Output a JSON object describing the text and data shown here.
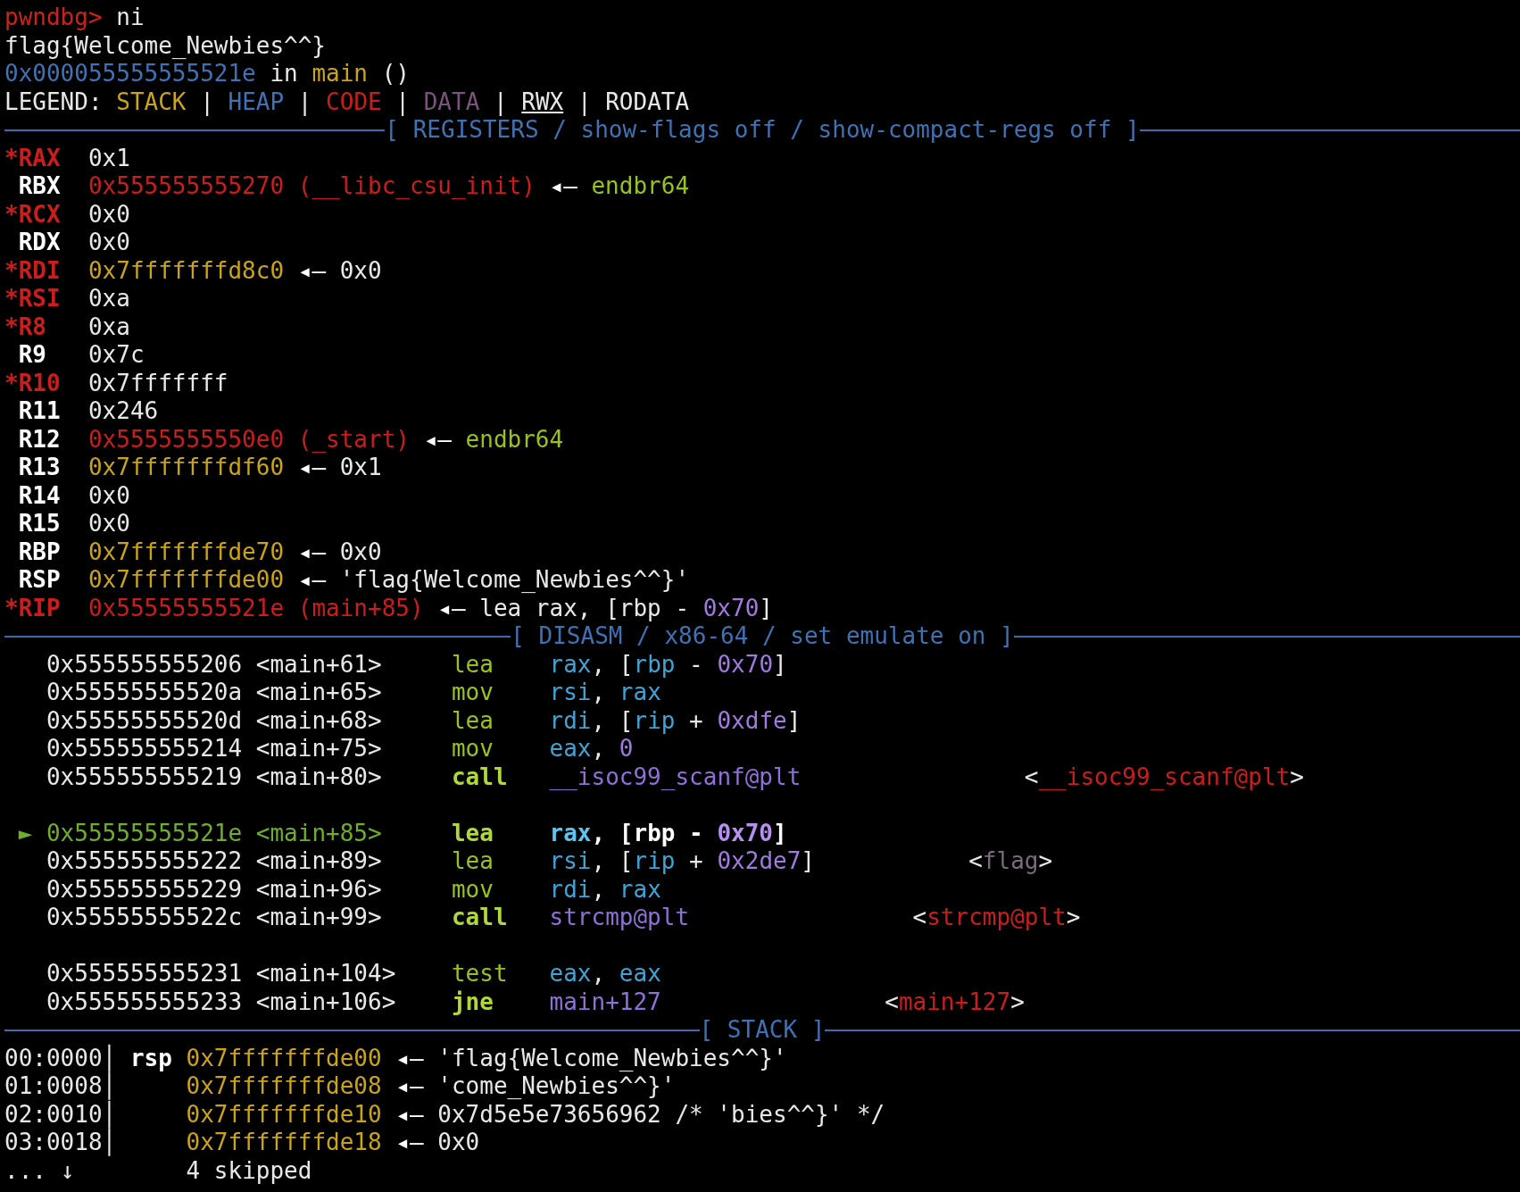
{
  "terminal": {
    "lines": [
      {
        "kind": "text",
        "segments": [
          {
            "kind": "prompt",
            "text": "pwndbg>"
          },
          {
            "kind": "plain",
            "text": " ni"
          }
        ]
      },
      {
        "kind": "text",
        "segments": [
          {
            "kind": "plain",
            "text": "flag{Welcome_Newbies^^}"
          }
        ]
      },
      {
        "kind": "text",
        "segments": [
          {
            "kind": "heap",
            "text": "0x000055555555521e"
          },
          {
            "kind": "plain",
            "text": " in"
          },
          {
            "kind": "function",
            "text": " main"
          },
          {
            "kind": "plain",
            "text": " ()"
          }
        ]
      },
      {
        "kind": "text",
        "segments": [
          {
            "kind": "plain",
            "text": "LEGEND:"
          },
          {
            "kind": "stack",
            "text": " STACK"
          },
          {
            "kind": "plain",
            "text": " |"
          },
          {
            "kind": "heap",
            "text": " HEAP"
          },
          {
            "kind": "plain",
            "text": " |"
          },
          {
            "kind": "code",
            "text": " CODE"
          },
          {
            "kind": "plain",
            "text": " |"
          },
          {
            "kind": "data",
            "text": " DATA"
          },
          {
            "kind": "plain",
            "text": " |"
          },
          {
            "kind": "rwx",
            "text": " RWX"
          },
          {
            "kind": "plain",
            "text": " |"
          },
          {
            "kind": "plain",
            "text": " RODATA"
          }
        ]
      },
      {
        "kind": "rule",
        "title": "[ REGISTERS / show-flags off / show-compact-regs off ]"
      },
      {
        "kind": "text",
        "segments": [
          {
            "kind": "reg-changed",
            "text": "*RAX"
          },
          {
            "kind": "plain",
            "text": "  0x1"
          }
        ]
      },
      {
        "kind": "text",
        "segments": [
          {
            "kind": "reg",
            "text": " RBX"
          },
          {
            "kind": "code",
            "text": "  0x555555555270 (__libc_csu_init)"
          },
          {
            "kind": "arrow",
            "text": " ◂—"
          },
          {
            "kind": "instr",
            "text": " endbr64"
          }
        ]
      },
      {
        "kind": "text",
        "segments": [
          {
            "kind": "reg-changed",
            "text": "*RCX"
          },
          {
            "kind": "plain",
            "text": "  0x0"
          }
        ]
      },
      {
        "kind": "text",
        "segments": [
          {
            "kind": "reg",
            "text": " RDX"
          },
          {
            "kind": "plain",
            "text": "  0x0"
          }
        ]
      },
      {
        "kind": "text",
        "segments": [
          {
            "kind": "reg-changed",
            "text": "*RDI"
          },
          {
            "kind": "stack",
            "text": "  0x7fffffffd8c0"
          },
          {
            "kind": "arrow",
            "text": " ◂—"
          },
          {
            "kind": "plain",
            "text": " 0x0"
          }
        ]
      },
      {
        "kind": "text",
        "segments": [
          {
            "kind": "reg-changed",
            "text": "*RSI"
          },
          {
            "kind": "plain",
            "text": "  0xa"
          }
        ]
      },
      {
        "kind": "text",
        "segments": [
          {
            "kind": "reg-changed",
            "text": "*R8"
          },
          {
            "kind": "plain",
            "text": "   0xa"
          }
        ]
      },
      {
        "kind": "text",
        "segments": [
          {
            "kind": "reg",
            "text": " R9"
          },
          {
            "kind": "plain",
            "text": "   0x7c"
          }
        ]
      },
      {
        "kind": "text",
        "segments": [
          {
            "kind": "reg-changed",
            "text": "*R10"
          },
          {
            "kind": "plain",
            "text": "  0x7fffffff"
          }
        ]
      },
      {
        "kind": "text",
        "segments": [
          {
            "kind": "reg",
            "text": " R11"
          },
          {
            "kind": "plain",
            "text": "  0x246"
          }
        ]
      },
      {
        "kind": "text",
        "segments": [
          {
            "kind": "reg",
            "text": " R12"
          },
          {
            "kind": "code",
            "text": "  0x5555555550e0 (_start)"
          },
          {
            "kind": "arrow",
            "text": " ◂—"
          },
          {
            "kind": "instr",
            "text": " endbr64"
          }
        ]
      },
      {
        "kind": "text",
        "segments": [
          {
            "kind": "reg",
            "text": " R13"
          },
          {
            "kind": "stack",
            "text": "  0x7fffffffdf60"
          },
          {
            "kind": "arrow",
            "text": " ◂—"
          },
          {
            "kind": "plain",
            "text": " 0x1"
          }
        ]
      },
      {
        "kind": "text",
        "segments": [
          {
            "kind": "reg",
            "text": " R14"
          },
          {
            "kind": "plain",
            "text": "  0x0"
          }
        ]
      },
      {
        "kind": "text",
        "segments": [
          {
            "kind": "reg",
            "text": " R15"
          },
          {
            "kind": "plain",
            "text": "  0x0"
          }
        ]
      },
      {
        "kind": "text",
        "segments": [
          {
            "kind": "reg",
            "text": " RBP"
          },
          {
            "kind": "stack",
            "text": "  0x7fffffffde70"
          },
          {
            "kind": "arrow",
            "text": " ◂—"
          },
          {
            "kind": "plain",
            "text": " 0x0"
          }
        ]
      },
      {
        "kind": "text",
        "segments": [
          {
            "kind": "reg",
            "text": " RSP"
          },
          {
            "kind": "stack",
            "text": "  0x7fffffffde00"
          },
          {
            "kind": "arrow",
            "text": " ◂—"
          },
          {
            "kind": "plain",
            "text": " 'flag{Welcome_Newbies^^}'"
          }
        ]
      },
      {
        "kind": "text",
        "segments": [
          {
            "kind": "reg-changed",
            "text": "*RIP"
          },
          {
            "kind": "code",
            "text": "  0x55555555521e (main+85)"
          },
          {
            "kind": "arrow",
            "text": " ◂—"
          },
          {
            "kind": "plain",
            "text": " lea rax, [rbp -"
          },
          {
            "kind": "immediate",
            "text": " 0x70"
          },
          {
            "kind": "plain",
            "text": "]"
          }
        ]
      },
      {
        "kind": "rule",
        "title": "[ DISASM / x86-64 / set emulate on ]"
      },
      {
        "kind": "text",
        "segments": [
          {
            "kind": "plain",
            "text": "   0x555555555206"
          },
          {
            "kind": "plain",
            "text": " <main+61>"
          },
          {
            "kind": "mnemonic",
            "text": "     lea"
          },
          {
            "kind": "operand",
            "text": "    rax"
          },
          {
            "kind": "plain",
            "text": ", ["
          },
          {
            "kind": "operand",
            "text": "rbp"
          },
          {
            "kind": "plain",
            "text": " -"
          },
          {
            "kind": "immediate",
            "text": " 0x70"
          },
          {
            "kind": "plain",
            "text": "]"
          }
        ]
      },
      {
        "kind": "text",
        "segments": [
          {
            "kind": "plain",
            "text": "   0x55555555520a"
          },
          {
            "kind": "plain",
            "text": " <main+65>"
          },
          {
            "kind": "mnemonic",
            "text": "     mov"
          },
          {
            "kind": "operand",
            "text": "    rsi"
          },
          {
            "kind": "plain",
            "text": ","
          },
          {
            "kind": "operand",
            "text": " rax"
          }
        ]
      },
      {
        "kind": "text",
        "segments": [
          {
            "kind": "plain",
            "text": "   0x55555555520d"
          },
          {
            "kind": "plain",
            "text": " <main+68>"
          },
          {
            "kind": "mnemonic",
            "text": "     lea"
          },
          {
            "kind": "operand",
            "text": "    rdi"
          },
          {
            "kind": "plain",
            "text": ", ["
          },
          {
            "kind": "operand",
            "text": "rip"
          },
          {
            "kind": "plain",
            "text": " +"
          },
          {
            "kind": "immediate",
            "text": " 0xdfe"
          },
          {
            "kind": "plain",
            "text": "]"
          }
        ]
      },
      {
        "kind": "text",
        "segments": [
          {
            "kind": "plain",
            "text": "   0x555555555214"
          },
          {
            "kind": "plain",
            "text": " <main+75>"
          },
          {
            "kind": "mnemonic",
            "text": "     mov"
          },
          {
            "kind": "operand",
            "text": "    eax"
          },
          {
            "kind": "plain",
            "text": ","
          },
          {
            "kind": "immediate",
            "text": " 0"
          }
        ]
      },
      {
        "kind": "text",
        "segments": [
          {
            "kind": "plain",
            "text": "   0x555555555219"
          },
          {
            "kind": "plain",
            "text": " <main+80>"
          },
          {
            "kind": "mnemonic-bold",
            "text": "     call"
          },
          {
            "kind": "target",
            "text": "   __isoc99_scanf@plt"
          },
          {
            "kind": "plain",
            "text": "                <"
          },
          {
            "kind": "code",
            "text": "__isoc99_scanf@plt"
          },
          {
            "kind": "plain",
            "text": ">"
          }
        ]
      },
      {
        "kind": "blank"
      },
      {
        "kind": "text",
        "segments": [
          {
            "kind": "marker",
            "text": " ►"
          },
          {
            "kind": "current",
            "text": " 0x55555555521e"
          },
          {
            "kind": "current",
            "text": " <main+85>"
          },
          {
            "kind": "mnemonic-bold",
            "text": "     lea"
          },
          {
            "kind": "operand-bold",
            "text": "    rax"
          },
          {
            "kind": "plain-bold",
            "text": ", [rbp -"
          },
          {
            "kind": "immediate-bold",
            "text": " 0x70"
          },
          {
            "kind": "plain-bold",
            "text": "]"
          }
        ]
      },
      {
        "kind": "text",
        "segments": [
          {
            "kind": "plain",
            "text": "   0x555555555222"
          },
          {
            "kind": "plain",
            "text": " <main+89>"
          },
          {
            "kind": "mnemonic",
            "text": "     lea"
          },
          {
            "kind": "operand",
            "text": "    rsi"
          },
          {
            "kind": "plain",
            "text": ", ["
          },
          {
            "kind": "operand",
            "text": "rip"
          },
          {
            "kind": "plain",
            "text": " +"
          },
          {
            "kind": "immediate",
            "text": " 0x2de7"
          },
          {
            "kind": "plain",
            "text": "]"
          },
          {
            "kind": "plain",
            "text": "           <"
          },
          {
            "kind": "dim",
            "text": "flag"
          },
          {
            "kind": "plain",
            "text": ">"
          }
        ]
      },
      {
        "kind": "text",
        "segments": [
          {
            "kind": "plain",
            "text": "   0x555555555229"
          },
          {
            "kind": "plain",
            "text": " <main+96>"
          },
          {
            "kind": "mnemonic",
            "text": "     mov"
          },
          {
            "kind": "operand",
            "text": "    rdi"
          },
          {
            "kind": "plain",
            "text": ","
          },
          {
            "kind": "operand",
            "text": " rax"
          }
        ]
      },
      {
        "kind": "text",
        "segments": [
          {
            "kind": "plain",
            "text": "   0x55555555522c"
          },
          {
            "kind": "plain",
            "text": " <main+99>"
          },
          {
            "kind": "mnemonic-bold",
            "text": "     call"
          },
          {
            "kind": "target",
            "text": "   strcmp@plt"
          },
          {
            "kind": "plain",
            "text": "                <"
          },
          {
            "kind": "code",
            "text": "strcmp@plt"
          },
          {
            "kind": "plain",
            "text": ">"
          }
        ]
      },
      {
        "kind": "blank"
      },
      {
        "kind": "text",
        "segments": [
          {
            "kind": "plain",
            "text": "   0x555555555231"
          },
          {
            "kind": "plain",
            "text": " <main+104>"
          },
          {
            "kind": "mnemonic",
            "text": "    test"
          },
          {
            "kind": "operand",
            "text": "   eax"
          },
          {
            "kind": "plain",
            "text": ","
          },
          {
            "kind": "operand",
            "text": " eax"
          }
        ]
      },
      {
        "kind": "text",
        "segments": [
          {
            "kind": "plain",
            "text": "   0x555555555233"
          },
          {
            "kind": "plain",
            "text": " <main+106>"
          },
          {
            "kind": "mnemonic-bold",
            "text": "    jne"
          },
          {
            "kind": "target",
            "text": "    main+127"
          },
          {
            "kind": "plain",
            "text": "                <"
          },
          {
            "kind": "code",
            "text": "main+127"
          },
          {
            "kind": "plain",
            "text": ">"
          }
        ]
      },
      {
        "kind": "rule",
        "title": "[ STACK ]"
      },
      {
        "kind": "text",
        "segments": [
          {
            "kind": "plain",
            "text": "00:0000"
          },
          {
            "kind": "plain",
            "text": "│"
          },
          {
            "kind": "plain-bold",
            "text": " rsp"
          },
          {
            "kind": "stack",
            "text": " 0x7fffffffde00"
          },
          {
            "kind": "arrow",
            "text": " ◂—"
          },
          {
            "kind": "plain",
            "text": " 'flag{Welcome_Newbies^^}'"
          }
        ]
      },
      {
        "kind": "text",
        "segments": [
          {
            "kind": "plain",
            "text": "01:0008"
          },
          {
            "kind": "plain",
            "text": "│"
          },
          {
            "kind": "stack",
            "text": "     0x7fffffffde08"
          },
          {
            "kind": "arrow",
            "text": " ◂—"
          },
          {
            "kind": "plain",
            "text": " 'come_Newbies^^}'"
          }
        ]
      },
      {
        "kind": "text",
        "segments": [
          {
            "kind": "plain",
            "text": "02:0010"
          },
          {
            "kind": "plain",
            "text": "│"
          },
          {
            "kind": "stack",
            "text": "     0x7fffffffde10"
          },
          {
            "kind": "arrow",
            "text": " ◂—"
          },
          {
            "kind": "plain",
            "text": " 0x7d5e5e73656962 /* 'bies^^}' */"
          }
        ]
      },
      {
        "kind": "text",
        "segments": [
          {
            "kind": "plain",
            "text": "03:0018"
          },
          {
            "kind": "plain",
            "text": "│"
          },
          {
            "kind": "stack",
            "text": "     0x7fffffffde18"
          },
          {
            "kind": "arrow",
            "text": " ◂—"
          },
          {
            "kind": "plain",
            "text": " 0x0"
          }
        ]
      },
      {
        "kind": "text",
        "segments": [
          {
            "kind": "plain",
            "text": "..."
          },
          {
            "kind": "plain",
            "text": " ↓"
          },
          {
            "kind": "plain",
            "text": "        4 skipped"
          }
        ]
      }
    ]
  }
}
